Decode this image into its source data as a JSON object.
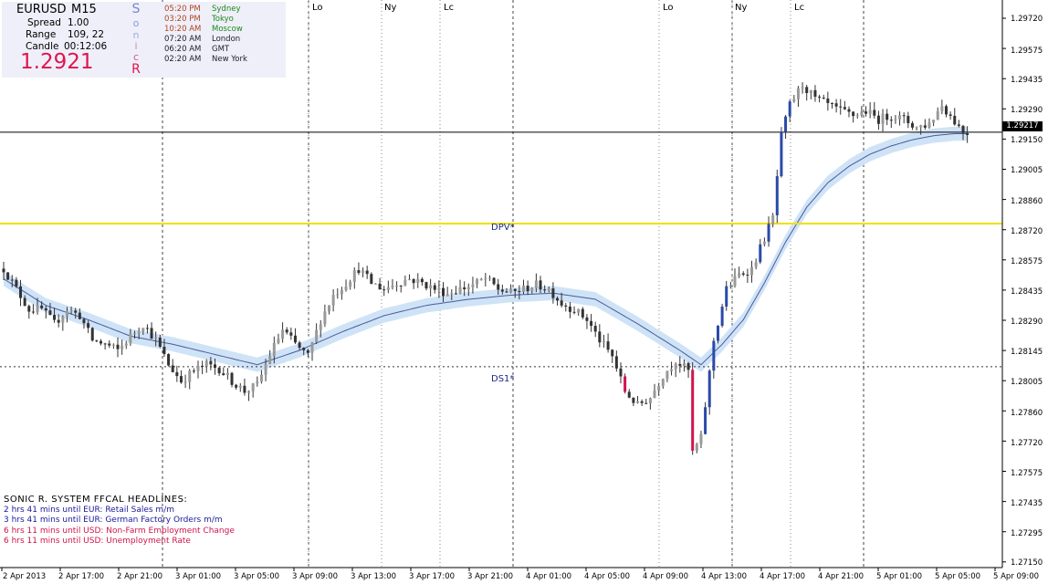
{
  "info": {
    "symbol": "EURUSD",
    "timeframe": "M15",
    "spread_label": "Spread",
    "spread_value": "1.00",
    "range_label": "Range",
    "range_value": "109, 22",
    "candle_label": "Candle",
    "candle_value": "00:12:06",
    "price": "1.2921"
  },
  "sonic_letters": [
    "S",
    "o",
    "n",
    "i",
    "c",
    "R"
  ],
  "sonic_colors": [
    "#7a86c8",
    "#8a9ad8",
    "#a0aee0",
    "#c088b8",
    "#d05a8e",
    "#e0144c"
  ],
  "sessions": [
    {
      "time": "05:20 PM",
      "city": "Sydney",
      "time_color": "#b0441a",
      "city_color": "#1a8a1a"
    },
    {
      "time": "03:20 PM",
      "city": "Tokyo",
      "time_color": "#b0441a",
      "city_color": "#1a8a1a"
    },
    {
      "time": "10:20 AM",
      "city": "Moscow",
      "time_color": "#b0441a",
      "city_color": "#1a8a1a"
    },
    {
      "time": "07:20 AM",
      "city": "London",
      "time_color": "#222222",
      "city_color": "#222222"
    },
    {
      "time": "06:20 AM",
      "city": "GMT",
      "time_color": "#222222",
      "city_color": "#222222"
    },
    {
      "time": "02:20 AM",
      "city": "New York",
      "time_color": "#222222",
      "city_color": "#222222"
    }
  ],
  "headlines": {
    "title": "SONIC R. SYSTEM  FFCAL HEADLINES:",
    "items": [
      {
        "text": "2 hrs 41 mins until EUR: Retail Sales m/m",
        "color": "#1a1a99"
      },
      {
        "text": "3 hrs 41 mins until EUR: German Factory Orders m/m",
        "color": "#1a1a99"
      },
      {
        "text": "6 hrs 11 mins until USD: Non-Farm Employment Change",
        "color": "#d0144c"
      },
      {
        "text": "6 hrs 11 mins until USD: Unemployment Rate",
        "color": "#d0144c"
      }
    ]
  },
  "session_labels": [
    {
      "text": "Lo"
    },
    {
      "text": "Ny"
    },
    {
      "text": "Lc"
    },
    {
      "text": "Lo"
    },
    {
      "text": "Ny"
    },
    {
      "text": "Lc"
    }
  ],
  "level_labels": {
    "dpv": "DPV*",
    "ds1": "DS1*"
  },
  "current_price_tag": "1.29217",
  "colors": {
    "bull_candle": "#2a4aa8",
    "bear_candle": "#d0144c",
    "neutral_candle": "#555555",
    "band": "#cfe3f7",
    "ema": "#4a5a9a",
    "pivot_line": "#f0e000"
  },
  "chart_data": {
    "type": "candlestick",
    "symbol": "EURUSD",
    "timeframe": "M15",
    "ylim": [
      1.2711,
      1.2977
    ],
    "y_ticks": [
      "1.29720",
      "1.29575",
      "1.29435",
      "1.29290",
      "1.29150",
      "1.29005",
      "1.28860",
      "1.28720",
      "1.28575",
      "1.28435",
      "1.28290",
      "1.28145",
      "1.28005",
      "1.27860",
      "1.27720",
      "1.27575",
      "1.27435",
      "1.27295",
      "1.27150"
    ],
    "x_ticks": [
      "2 Apr 2013",
      "2 Apr 17:00",
      "2 Apr 21:00",
      "3 Apr 01:00",
      "3 Apr 05:00",
      "3 Apr 09:00",
      "3 Apr 13:00",
      "3 Apr 17:00",
      "3 Apr 21:00",
      "4 Apr 01:00",
      "4 Apr 05:00",
      "4 Apr 09:00",
      "4 Apr 13:00",
      "4 Apr 17:00",
      "4 Apr 21:00",
      "5 Apr 01:00",
      "5 Apr 05:00",
      "5 Apr 09:00"
    ],
    "current_price": 1.29217,
    "pivot_dpv": 1.2877,
    "pivot_ds1": 1.2807,
    "close_path": [
      [
        0,
        1.2855
      ],
      [
        3,
        1.2845
      ],
      [
        6,
        1.2835
      ],
      [
        9,
        1.2835
      ],
      [
        12,
        1.2828
      ],
      [
        15,
        1.2835
      ],
      [
        18,
        1.2832
      ],
      [
        21,
        1.282
      ],
      [
        24,
        1.2818
      ],
      [
        27,
        1.2815
      ],
      [
        30,
        1.2822
      ],
      [
        33,
        1.2828
      ],
      [
        36,
        1.282
      ],
      [
        39,
        1.2808
      ],
      [
        42,
        1.28
      ],
      [
        45,
        1.2805
      ],
      [
        48,
        1.2808
      ],
      [
        51,
        1.2806
      ],
      [
        54,
        1.28
      ],
      [
        57,
        1.2795
      ],
      [
        60,
        1.2798
      ],
      [
        63,
        1.2813
      ],
      [
        66,
        1.2825
      ],
      [
        69,
        1.2818
      ],
      [
        72,
        1.2812
      ],
      [
        75,
        1.283
      ],
      [
        78,
        1.2842
      ],
      [
        81,
        1.2848
      ],
      [
        84,
        1.2855
      ],
      [
        87,
        1.2848
      ],
      [
        90,
        1.2845
      ],
      [
        93,
        1.2848
      ],
      [
        96,
        1.285
      ],
      [
        99,
        1.2848
      ],
      [
        102,
        1.2845
      ],
      [
        105,
        1.2843
      ],
      [
        108,
        1.2845
      ],
      [
        111,
        1.2847
      ],
      [
        114,
        1.285
      ],
      [
        117,
        1.2845
      ],
      [
        120,
        1.2843
      ],
      [
        123,
        1.2845
      ],
      [
        126,
        1.2847
      ],
      [
        129,
        1.2845
      ],
      [
        132,
        1.2838
      ],
      [
        135,
        1.2835
      ],
      [
        138,
        1.283
      ],
      [
        141,
        1.282
      ],
      [
        144,
        1.2812
      ],
      [
        147,
        1.2795
      ],
      [
        150,
        1.2788
      ],
      [
        153,
        1.2792
      ],
      [
        156,
        1.2803
      ],
      [
        159,
        1.281
      ],
      [
        162,
        1.2805
      ],
      [
        163,
        1.2765
      ],
      [
        165,
        1.2772
      ],
      [
        168,
        1.282
      ],
      [
        171,
        1.2845
      ],
      [
        174,
        1.2852
      ],
      [
        177,
        1.2855
      ],
      [
        180,
        1.287
      ],
      [
        182,
        1.288
      ],
      [
        184,
        1.292
      ],
      [
        186,
        1.2935
      ],
      [
        189,
        1.2945
      ],
      [
        192,
        1.2938
      ],
      [
        195,
        1.2935
      ],
      [
        198,
        1.2932
      ],
      [
        201,
        1.293
      ],
      [
        204,
        1.2932
      ],
      [
        207,
        1.2928
      ],
      [
        210,
        1.293
      ],
      [
        213,
        1.2928
      ],
      [
        216,
        1.2924
      ],
      [
        219,
        1.2926
      ],
      [
        222,
        1.2935
      ],
      [
        225,
        1.2927
      ],
      [
        227,
        1.2922
      ],
      [
        228,
        1.29217
      ]
    ],
    "ema_path": [
      [
        0,
        1.285
      ],
      [
        10,
        1.2837
      ],
      [
        20,
        1.283
      ],
      [
        30,
        1.2822
      ],
      [
        40,
        1.2818
      ],
      [
        50,
        1.2813
      ],
      [
        60,
        1.2808
      ],
      [
        70,
        1.2815
      ],
      [
        80,
        1.2824
      ],
      [
        90,
        1.2832
      ],
      [
        100,
        1.2837
      ],
      [
        110,
        1.284
      ],
      [
        120,
        1.2842
      ],
      [
        130,
        1.2843
      ],
      [
        140,
        1.284
      ],
      [
        150,
        1.2828
      ],
      [
        160,
        1.2815
      ],
      [
        165,
        1.2808
      ],
      [
        170,
        1.2818
      ],
      [
        175,
        1.283
      ],
      [
        180,
        1.2848
      ],
      [
        185,
        1.2868
      ],
      [
        190,
        1.2885
      ],
      [
        195,
        1.2897
      ],
      [
        200,
        1.2905
      ],
      [
        205,
        1.2911
      ],
      [
        210,
        1.2915
      ],
      [
        215,
        1.2918
      ],
      [
        220,
        1.292
      ],
      [
        225,
        1.2921
      ],
      [
        228,
        1.2921
      ]
    ],
    "band_width": 0.00035
  }
}
